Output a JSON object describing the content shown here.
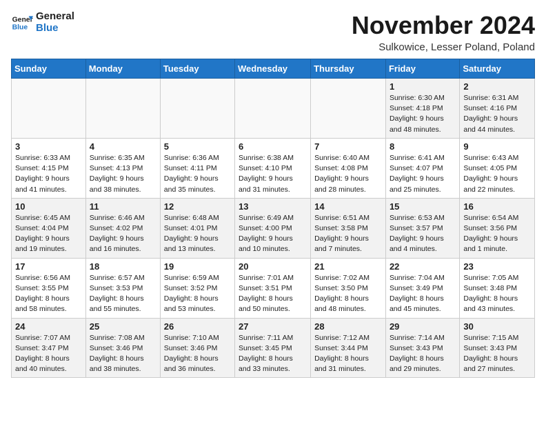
{
  "logo": {
    "line1": "General",
    "line2": "Blue"
  },
  "title": "November 2024",
  "location": "Sulkowice, Lesser Poland, Poland",
  "days_of_week": [
    "Sunday",
    "Monday",
    "Tuesday",
    "Wednesday",
    "Thursday",
    "Friday",
    "Saturday"
  ],
  "weeks": [
    [
      {
        "day": "",
        "info": ""
      },
      {
        "day": "",
        "info": ""
      },
      {
        "day": "",
        "info": ""
      },
      {
        "day": "",
        "info": ""
      },
      {
        "day": "",
        "info": ""
      },
      {
        "day": "1",
        "info": "Sunrise: 6:30 AM\nSunset: 4:18 PM\nDaylight: 9 hours and 48 minutes."
      },
      {
        "day": "2",
        "info": "Sunrise: 6:31 AM\nSunset: 4:16 PM\nDaylight: 9 hours and 44 minutes."
      }
    ],
    [
      {
        "day": "3",
        "info": "Sunrise: 6:33 AM\nSunset: 4:15 PM\nDaylight: 9 hours and 41 minutes."
      },
      {
        "day": "4",
        "info": "Sunrise: 6:35 AM\nSunset: 4:13 PM\nDaylight: 9 hours and 38 minutes."
      },
      {
        "day": "5",
        "info": "Sunrise: 6:36 AM\nSunset: 4:11 PM\nDaylight: 9 hours and 35 minutes."
      },
      {
        "day": "6",
        "info": "Sunrise: 6:38 AM\nSunset: 4:10 PM\nDaylight: 9 hours and 31 minutes."
      },
      {
        "day": "7",
        "info": "Sunrise: 6:40 AM\nSunset: 4:08 PM\nDaylight: 9 hours and 28 minutes."
      },
      {
        "day": "8",
        "info": "Sunrise: 6:41 AM\nSunset: 4:07 PM\nDaylight: 9 hours and 25 minutes."
      },
      {
        "day": "9",
        "info": "Sunrise: 6:43 AM\nSunset: 4:05 PM\nDaylight: 9 hours and 22 minutes."
      }
    ],
    [
      {
        "day": "10",
        "info": "Sunrise: 6:45 AM\nSunset: 4:04 PM\nDaylight: 9 hours and 19 minutes."
      },
      {
        "day": "11",
        "info": "Sunrise: 6:46 AM\nSunset: 4:02 PM\nDaylight: 9 hours and 16 minutes."
      },
      {
        "day": "12",
        "info": "Sunrise: 6:48 AM\nSunset: 4:01 PM\nDaylight: 9 hours and 13 minutes."
      },
      {
        "day": "13",
        "info": "Sunrise: 6:49 AM\nSunset: 4:00 PM\nDaylight: 9 hours and 10 minutes."
      },
      {
        "day": "14",
        "info": "Sunrise: 6:51 AM\nSunset: 3:58 PM\nDaylight: 9 hours and 7 minutes."
      },
      {
        "day": "15",
        "info": "Sunrise: 6:53 AM\nSunset: 3:57 PM\nDaylight: 9 hours and 4 minutes."
      },
      {
        "day": "16",
        "info": "Sunrise: 6:54 AM\nSunset: 3:56 PM\nDaylight: 9 hours and 1 minute."
      }
    ],
    [
      {
        "day": "17",
        "info": "Sunrise: 6:56 AM\nSunset: 3:55 PM\nDaylight: 8 hours and 58 minutes."
      },
      {
        "day": "18",
        "info": "Sunrise: 6:57 AM\nSunset: 3:53 PM\nDaylight: 8 hours and 55 minutes."
      },
      {
        "day": "19",
        "info": "Sunrise: 6:59 AM\nSunset: 3:52 PM\nDaylight: 8 hours and 53 minutes."
      },
      {
        "day": "20",
        "info": "Sunrise: 7:01 AM\nSunset: 3:51 PM\nDaylight: 8 hours and 50 minutes."
      },
      {
        "day": "21",
        "info": "Sunrise: 7:02 AM\nSunset: 3:50 PM\nDaylight: 8 hours and 48 minutes."
      },
      {
        "day": "22",
        "info": "Sunrise: 7:04 AM\nSunset: 3:49 PM\nDaylight: 8 hours and 45 minutes."
      },
      {
        "day": "23",
        "info": "Sunrise: 7:05 AM\nSunset: 3:48 PM\nDaylight: 8 hours and 43 minutes."
      }
    ],
    [
      {
        "day": "24",
        "info": "Sunrise: 7:07 AM\nSunset: 3:47 PM\nDaylight: 8 hours and 40 minutes."
      },
      {
        "day": "25",
        "info": "Sunrise: 7:08 AM\nSunset: 3:46 PM\nDaylight: 8 hours and 38 minutes."
      },
      {
        "day": "26",
        "info": "Sunrise: 7:10 AM\nSunset: 3:46 PM\nDaylight: 8 hours and 36 minutes."
      },
      {
        "day": "27",
        "info": "Sunrise: 7:11 AM\nSunset: 3:45 PM\nDaylight: 8 hours and 33 minutes."
      },
      {
        "day": "28",
        "info": "Sunrise: 7:12 AM\nSunset: 3:44 PM\nDaylight: 8 hours and 31 minutes."
      },
      {
        "day": "29",
        "info": "Sunrise: 7:14 AM\nSunset: 3:43 PM\nDaylight: 8 hours and 29 minutes."
      },
      {
        "day": "30",
        "info": "Sunrise: 7:15 AM\nSunset: 3:43 PM\nDaylight: 8 hours and 27 minutes."
      }
    ]
  ]
}
